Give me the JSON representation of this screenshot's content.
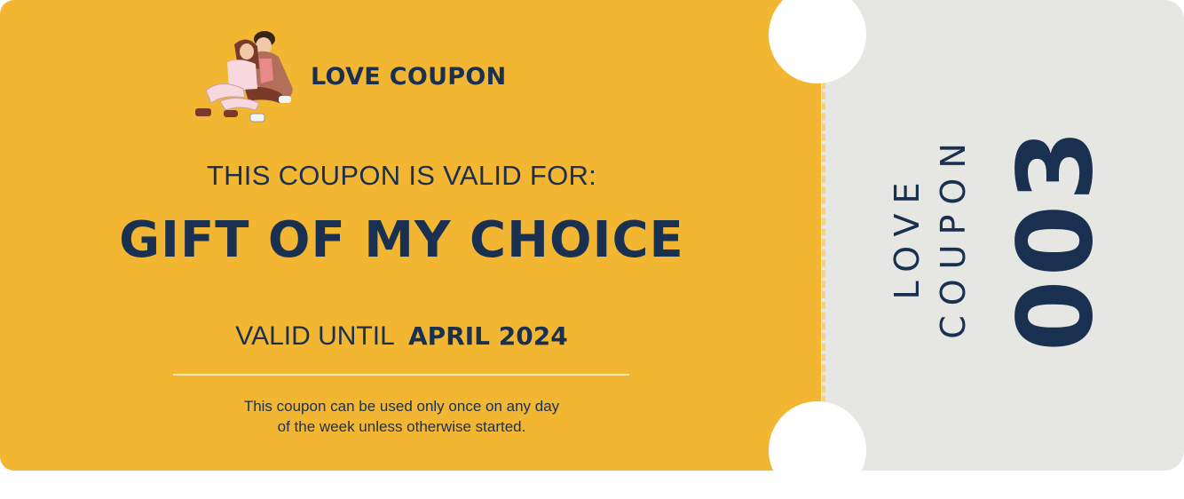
{
  "brand": {
    "title": "LOVE COUPON",
    "illustration": "couple-illustration"
  },
  "coupon": {
    "valid_for_label": "THIS COUPON IS VALID FOR:",
    "offer": "GIFT OF MY CHOICE",
    "valid_until_label": "VALID UNTIL",
    "valid_until_date": "APRIL 2024",
    "terms_line1": "This coupon can be used only once on any day",
    "terms_line2": "of the week unless otherwise started."
  },
  "stub": {
    "word1": "LOVE",
    "word2": "COUPON",
    "number": "003"
  },
  "colors": {
    "ticket": "#f2b632",
    "stub": "#e6e6e2",
    "text": "#1a3050"
  }
}
